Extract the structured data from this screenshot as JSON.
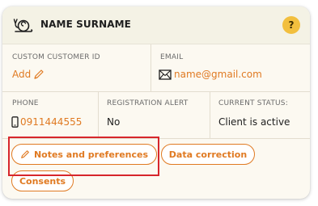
{
  "header": {
    "name": "NAME SURNAME",
    "help_symbol": "?"
  },
  "customer_id": {
    "label": "CUSTOM CUSTOMER ID",
    "value": "Add"
  },
  "email": {
    "label": "EMAIL",
    "value": "name@gmail.com"
  },
  "phone": {
    "label": "PHONE",
    "value": "0911444555"
  },
  "registration_alert": {
    "label": "REGISTRATION ALERT",
    "value": "No"
  },
  "current_status": {
    "label": "CURRENT STATUS:",
    "value": "Client is active"
  },
  "actions": {
    "notes": "Notes and preferences",
    "data_correction": "Data correction",
    "consents": "Consents"
  },
  "colors": {
    "accent": "#e07a22",
    "help_badge": "#f2bf3e",
    "highlight": "#d7262c"
  },
  "icons": [
    "snail-icon",
    "pencil-icon",
    "envelope-icon",
    "mobile-phone-icon"
  ]
}
